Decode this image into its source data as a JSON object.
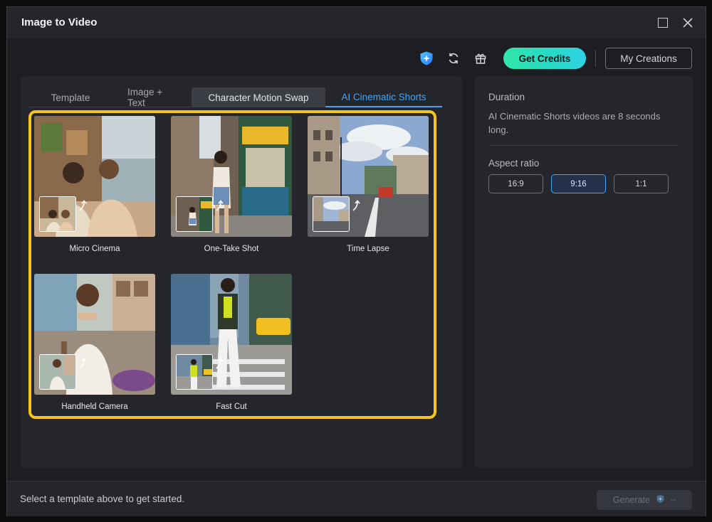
{
  "window": {
    "title": "Image to Video",
    "maximize_icon": "maximize-icon",
    "close_icon": "close-icon"
  },
  "toolbar": {
    "icons": [
      "ai-credits-icon",
      "refresh-icon",
      "gift-icon"
    ],
    "get_credits_label": "Get Credits",
    "my_creations_label": "My Creations"
  },
  "tabs": [
    {
      "label": "Template",
      "state": "normal"
    },
    {
      "label": "Image + Text",
      "state": "normal"
    },
    {
      "label": "Character Motion Swap",
      "state": "hover"
    },
    {
      "label": "AI Cinematic Shorts",
      "state": "active"
    }
  ],
  "templates": [
    {
      "label": "Micro Cinema"
    },
    {
      "label": "One-Take Shot"
    },
    {
      "label": "Time Lapse"
    },
    {
      "label": "Handheld Camera"
    },
    {
      "label": "Fast Cut"
    }
  ],
  "settings": {
    "duration_heading": "Duration",
    "duration_text": "AI Cinematic Shorts videos are 8 seconds long.",
    "aspect_heading": "Aspect ratio",
    "aspect_options": [
      "16:9",
      "9:16",
      "1:1"
    ],
    "aspect_selected": "9:16"
  },
  "footer": {
    "hint": "Select a template above to get started.",
    "generate_label": "Generate",
    "generate_cost": "--"
  },
  "colors": {
    "accent_blue": "#3ea6ff",
    "credits_gradient_start": "#2fe6a8",
    "credits_gradient_end": "#2fd3e6",
    "highlight_frame": "#f5c518"
  }
}
